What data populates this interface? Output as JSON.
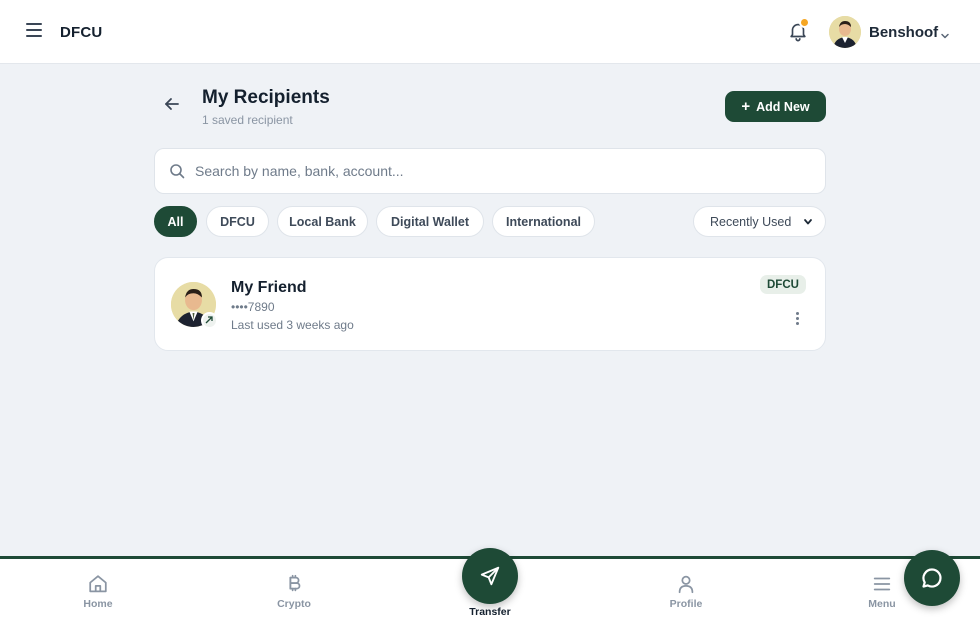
{
  "header": {
    "brand": "DFCU",
    "user_name": "Benshoof",
    "notification_dot_color": "#f5a623"
  },
  "page": {
    "title": "My Recipients",
    "subtitle": "1 saved recipient",
    "add_button_label": "Add New"
  },
  "search": {
    "placeholder": "Search by name, bank, account...",
    "value": ""
  },
  "filters": [
    {
      "label": "All",
      "active": true
    },
    {
      "label": "DFCU",
      "active": false
    },
    {
      "label": "Local Bank",
      "active": false
    },
    {
      "label": "Digital Wallet",
      "active": false
    },
    {
      "label": "International",
      "active": false
    }
  ],
  "sort": {
    "selected": "Recently Used"
  },
  "recipients": [
    {
      "name": "My Friend",
      "account": "••••7890",
      "last_used": "Last used 3 weeks ago",
      "bank": "DFCU"
    }
  ],
  "bottom_nav": {
    "items": [
      {
        "label": "Home",
        "icon": "home-icon"
      },
      {
        "label": "Crypto",
        "icon": "bitcoin-icon"
      },
      {
        "label": "Transfer",
        "icon": "send-icon"
      },
      {
        "label": "Profile",
        "icon": "user-icon"
      },
      {
        "label": "Menu",
        "icon": "menu-icon"
      }
    ]
  },
  "colors": {
    "primary": "#1e4a36",
    "background": "#eff2f6",
    "accent_orange": "#f5a623"
  }
}
